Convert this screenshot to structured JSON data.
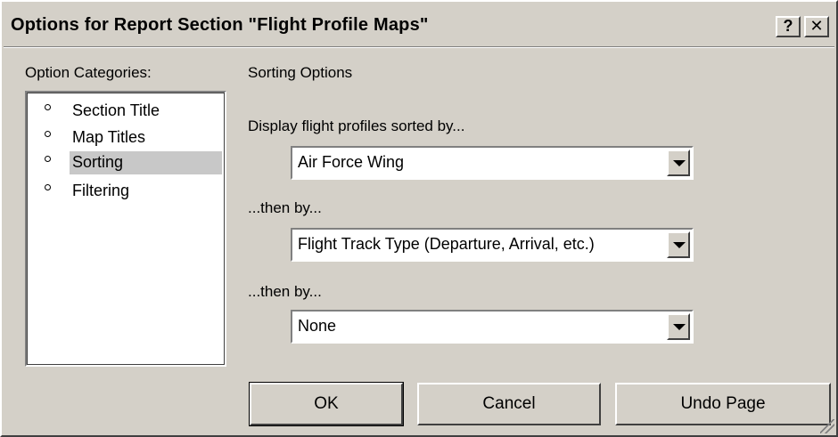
{
  "dialog": {
    "title": "Options for Report Section \"Flight Profile Maps\"",
    "help_label": "?",
    "close_label": "✕"
  },
  "categories": {
    "label": "Option Categories:",
    "items": [
      {
        "label": "Section Title",
        "selected": false
      },
      {
        "label": "Map Titles",
        "selected": false
      },
      {
        "label": "Sorting",
        "selected": true
      },
      {
        "label": "Filtering",
        "selected": false
      }
    ]
  },
  "sorting": {
    "heading": "Sorting Options",
    "primary": {
      "prompt": "Display flight profiles sorted by...",
      "value": "Air Force Wing"
    },
    "secondary": {
      "prompt": "...then by...",
      "value": "Flight Track Type  (Departure, Arrival, etc.)"
    },
    "tertiary": {
      "prompt": "...then by...",
      "value": "None"
    }
  },
  "buttons": {
    "ok": "OK",
    "cancel": "Cancel",
    "undo": "Undo Page"
  },
  "icons": {
    "help": "help-icon",
    "close": "close-icon",
    "dropdown": "chevron-down-icon",
    "bullet": "bullet-icon",
    "grip": "resize-grip-icon"
  }
}
